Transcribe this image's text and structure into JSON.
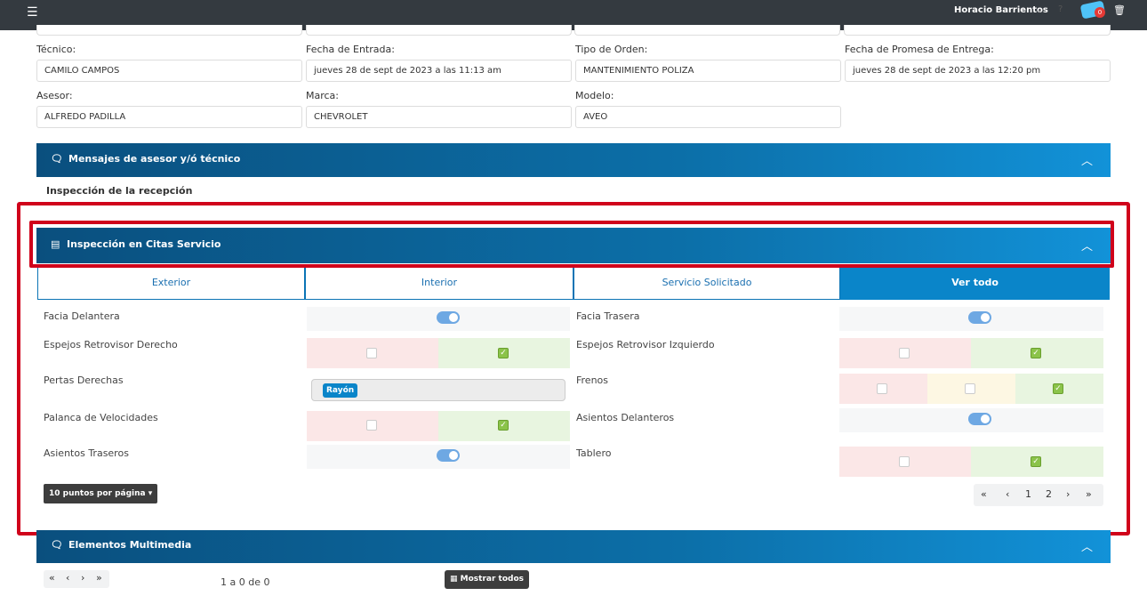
{
  "topbar": {
    "menu_icon": "hamburger-icon",
    "user_name": "Horacio Barrientos",
    "user_chevron": "chevron-down-icon",
    "help": "?",
    "notifications_count": "0",
    "trash_icon": "trash-icon"
  },
  "form": {
    "tecnico": {
      "label": "Técnico:",
      "value": "CAMILO CAMPOS"
    },
    "fecha_entrada": {
      "label": "Fecha de Entrada:",
      "value": "jueves 28 de sept de 2023 a las 11:13 am"
    },
    "tipo_orden": {
      "label": "Tipo de Orden:",
      "value": "MANTENIMIENTO POLIZA"
    },
    "fecha_promesa": {
      "label": "Fecha de Promesa de Entrega:",
      "value": "jueves 28 de sept de 2023 a las 12:20 pm"
    },
    "asesor": {
      "label": "Asesor:",
      "value": "ALFREDO PADILLA"
    },
    "marca": {
      "label": "Marca:",
      "value": "CHEVROLET"
    },
    "modelo": {
      "label": "Modelo:",
      "value": "AVEO"
    }
  },
  "mensajes_header": {
    "title": "Mensajes de asesor y/ó técnico",
    "icon": "comments-icon",
    "chevron": "︿"
  },
  "subtitle": "Inspección de la recepción",
  "inspeccion": {
    "title": "Inspección en Citas Servicio",
    "icon": "table-icon",
    "chevron": "︿",
    "tabs": [
      {
        "label": "Exterior",
        "active": false
      },
      {
        "label": "Interior",
        "active": false
      },
      {
        "label": "Servicio Solicitado",
        "active": false
      },
      {
        "label": "Ver todo",
        "active": true
      }
    ],
    "rows_left": [
      {
        "label": "Facia Delantera",
        "control": "toggle",
        "on": true
      },
      {
        "label": "Espejos Retrovisor Derecho",
        "control": "check2",
        "checked": [
          false,
          true
        ]
      },
      {
        "label": "Pertas Derechas",
        "control": "tag",
        "tag": "Rayón"
      },
      {
        "label": "Palanca de Velocidades",
        "control": "check2",
        "checked": [
          false,
          true
        ]
      },
      {
        "label": "Asientos Traseros",
        "control": "toggle",
        "on": true
      }
    ],
    "rows_right": [
      {
        "label": "Facia Trasera",
        "control": "toggle",
        "on": true
      },
      {
        "label": "Espejos Retrovisor Izquierdo",
        "control": "check2",
        "checked": [
          false,
          true
        ]
      },
      {
        "label": "Frenos",
        "control": "check3",
        "checked": [
          false,
          false,
          true
        ]
      },
      {
        "label": "Asientos Delanteros",
        "control": "toggle",
        "on": true
      },
      {
        "label": "Tablero",
        "control": "check2",
        "checked": [
          false,
          true
        ]
      }
    ],
    "per_page": "10 puntos por página ▾",
    "pagination": {
      "first": "«",
      "prev": "‹",
      "pages": [
        "1",
        "2"
      ],
      "next": "›",
      "last": "»"
    }
  },
  "multimedia": {
    "title": "Elementos Multimedia",
    "icon": "comments-icon",
    "chevron": "︿",
    "pagination": {
      "first": "«",
      "prev": "‹",
      "next": "›",
      "last": "»"
    },
    "count_text": "1 a 0 de 0",
    "show_all": "Mostrar todos",
    "show_all_icon": "grid-icon"
  },
  "colors": {
    "header_gradient_start": "#0a4f7e",
    "header_gradient_end": "#1292d8",
    "highlight": "#d0021b",
    "active_tab": "#0a85c9"
  }
}
